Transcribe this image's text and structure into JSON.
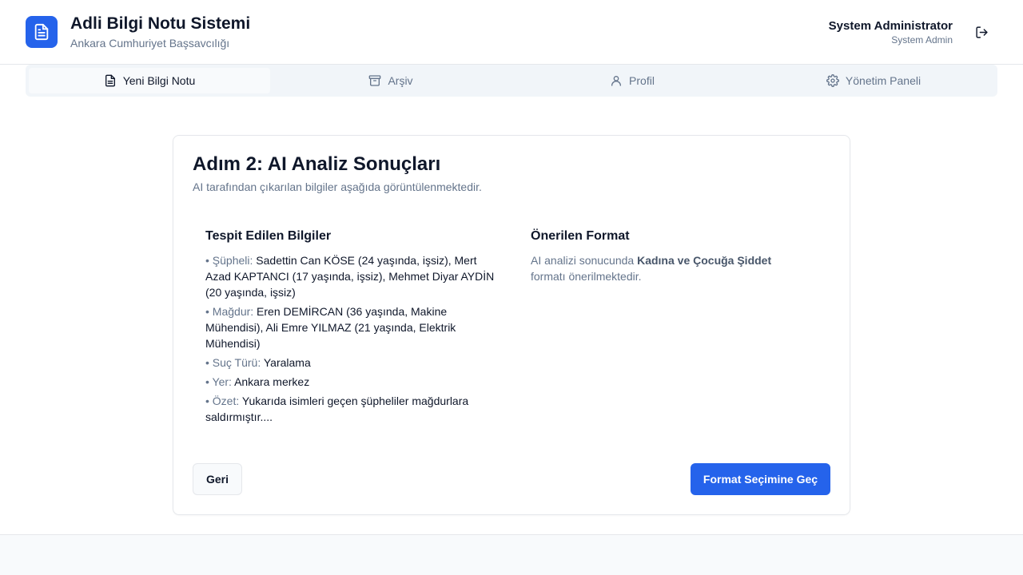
{
  "header": {
    "title": "Adli Bilgi Notu Sistemi",
    "subtitle": "Ankara Cumhuriyet Başsavcılığı",
    "user_name": "System Administrator",
    "user_role": "System Admin",
    "logo_icon": "document-icon",
    "logout_icon": "logout-icon"
  },
  "tabs": [
    {
      "label": "Yeni Bilgi Notu",
      "icon": "document-icon",
      "active": true
    },
    {
      "label": "Arşiv",
      "icon": "archive-icon",
      "active": false
    },
    {
      "label": "Profil",
      "icon": "user-icon",
      "active": false
    },
    {
      "label": "Yönetim Paneli",
      "icon": "gear-icon",
      "active": false
    }
  ],
  "card": {
    "title": "Adım 2: AI Analiz Sonuçları",
    "description": "AI tarafından çıkarılan bilgiler aşağıda görüntülenmektedir."
  },
  "detected": {
    "title": "Tespit Edilen Bilgiler",
    "items": [
      {
        "label": "Şüpheli:",
        "value": "Sadettin Can KÖSE (24 yaşında, işsiz), Mert Azad KAPTANCI (17 yaşında, işsiz), Mehmet Diyar AYDİN (20 yaşında, işsiz)"
      },
      {
        "label": "Mağdur:",
        "value": "Eren DEMİRCAN (36 yaşında, Makine Mühendisi), Ali Emre YILMAZ (21 yaşında, Elektrik Mühendisi)"
      },
      {
        "label": "Suç Türü:",
        "value": "Yaralama"
      },
      {
        "label": "Yer:",
        "value": "Ankara merkez"
      },
      {
        "label": "Özet:",
        "value": "Yukarıda isimleri geçen şüpheliler mağdurlara saldırmıştır...."
      }
    ]
  },
  "recommended": {
    "title": "Önerilen Format",
    "prefix": "AI analizi sonucunda",
    "format_name": "Kadına ve Çocuğa Şiddet",
    "suffix": "formatı önerilmektedir."
  },
  "buttons": {
    "back": "Geri",
    "next": "Format Seçimine Geç"
  },
  "colors": {
    "accent": "#2563eb",
    "muted": "#64748b"
  }
}
